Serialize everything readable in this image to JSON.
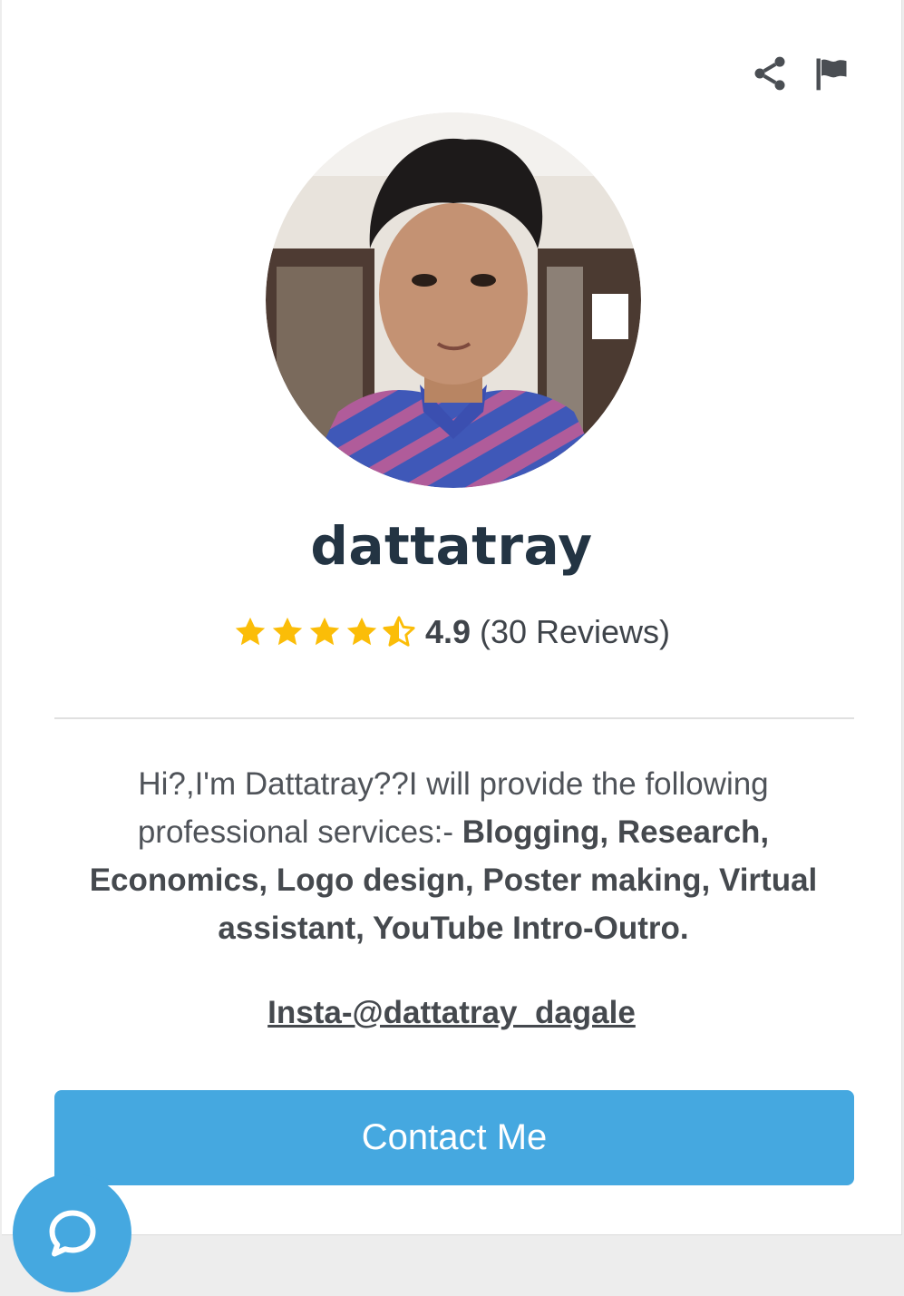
{
  "profile": {
    "name": "dattatray",
    "avatar_alt": "profile-photo"
  },
  "rating": {
    "value": "4.9",
    "count_text": "(30 Reviews)",
    "stars": 4.5,
    "star_color": "#fbbd08"
  },
  "bio": {
    "intro": "Hi?,I'm Dattatray??I will provide the following professional services:- ",
    "services": "Blogging, Research, Economics, Logo design, Poster making, Virtual assistant, YouTube Intro-Outro."
  },
  "social": {
    "instagram": "Insta-@dattatray_dagale"
  },
  "actions": {
    "contact_label": "Contact Me",
    "share_icon": "share-icon",
    "report_icon": "flag-icon",
    "chat_icon": "chat-bubble-icon"
  },
  "colors": {
    "accent": "#45a8e0",
    "name": "#233443",
    "text": "#4f5359"
  }
}
